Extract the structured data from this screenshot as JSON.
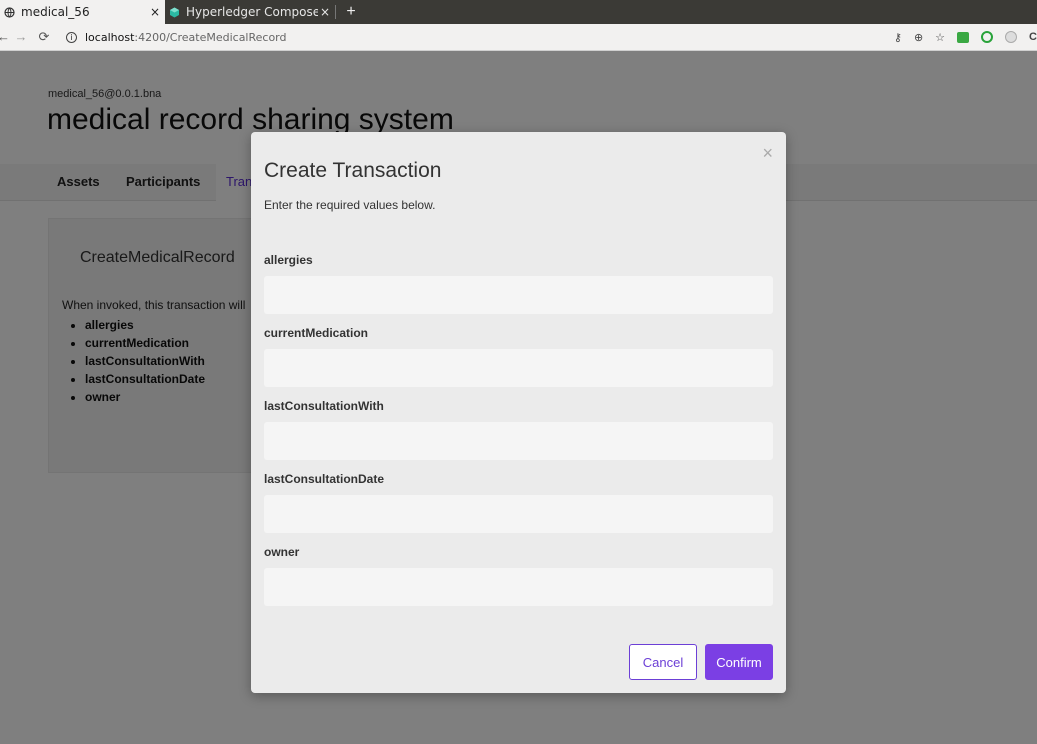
{
  "browser": {
    "tabs": [
      {
        "label": "medical_56",
        "close": "×"
      },
      {
        "label": "Hyperledger Composer R",
        "close": "×"
      }
    ],
    "new_tab": "+",
    "url_host": "localhost",
    "url_path": ":4200/CreateMedicalRecord"
  },
  "app": {
    "subtitle": "medical_56@0.0.1.bna",
    "title": "medical record sharing system",
    "nav": [
      "Assets",
      "Participants",
      "Tran"
    ]
  },
  "card": {
    "title": "CreateMedicalRecord",
    "description": "When invoked, this transaction will",
    "fields": [
      "allergies",
      "currentMedication",
      "lastConsultationWith",
      "lastConsultationDate",
      "owner"
    ]
  },
  "modal": {
    "close": "×",
    "title": "Create Transaction",
    "description": "Enter the required values below.",
    "fields": [
      {
        "label": "allergies",
        "value": ""
      },
      {
        "label": "currentMedication",
        "value": ""
      },
      {
        "label": "lastConsultationWith",
        "value": ""
      },
      {
        "label": "lastConsultationDate",
        "value": ""
      },
      {
        "label": "owner",
        "value": ""
      }
    ],
    "cancel": "Cancel",
    "confirm": "Confirm"
  },
  "colors": {
    "accent": "#7b3fe4",
    "overlay": "rgba(0,0,0,0.5)"
  }
}
